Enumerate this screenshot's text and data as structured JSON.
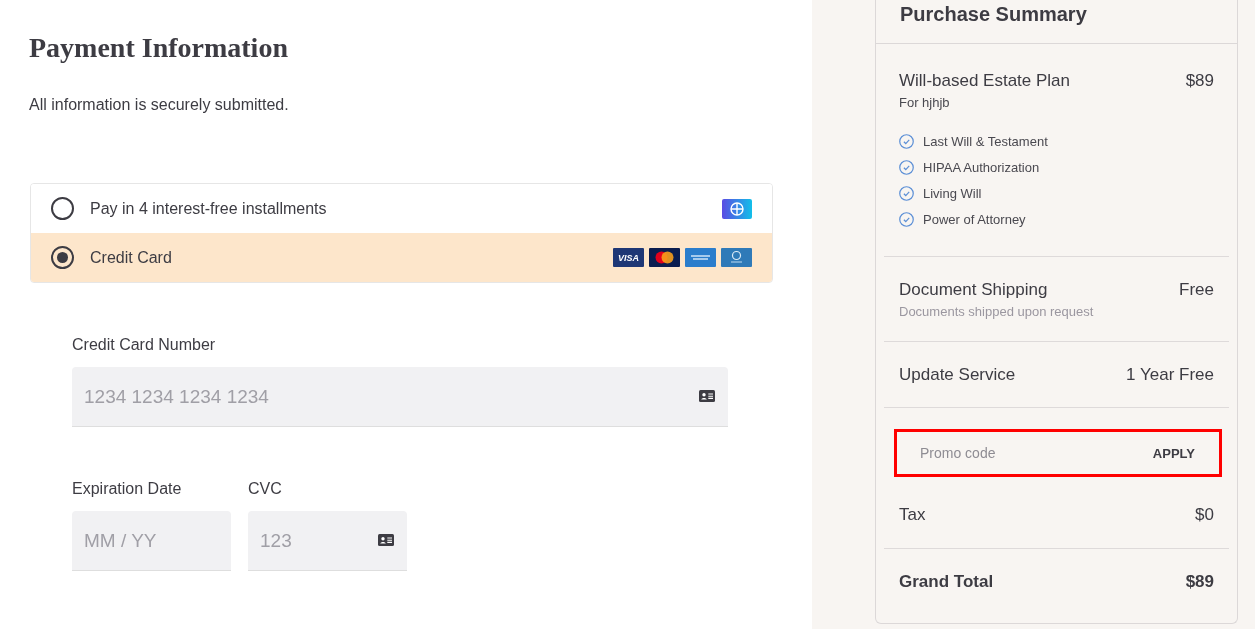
{
  "payment": {
    "title": "Payment Information",
    "subtitle": "All information is securely submitted.",
    "methods": [
      {
        "label": "Pay in 4 interest-free installments",
        "selected": false,
        "kind": "installments"
      },
      {
        "label": "Credit Card",
        "selected": true,
        "kind": "card",
        "brands": [
          {
            "kind": "visa",
            "text": "VISA"
          },
          {
            "kind": "mastercard"
          },
          {
            "kind": "amex"
          },
          {
            "kind": "diners"
          }
        ]
      }
    ],
    "card_number": {
      "label": "Credit Card Number",
      "placeholder": "1234 1234 1234 1234"
    },
    "expiry": {
      "label": "Expiration Date",
      "placeholder": "MM / YY"
    },
    "cvc": {
      "label": "CVC",
      "placeholder": "123"
    }
  },
  "summary": {
    "title": "Purchase Summary",
    "items": [
      {
        "kind": "plan",
        "name": "Will-based Estate Plan",
        "price": "$89",
        "note": "For hjhjb",
        "features": [
          "Last Will & Testament",
          "HIPAA Authorization",
          "Living Will",
          "Power of Attorney"
        ]
      },
      {
        "kind": "shipping",
        "name": "Document Shipping",
        "price": "Free",
        "note": "Documents shipped upon request"
      },
      {
        "kind": "service",
        "name": "Update Service",
        "price": "1 Year Free"
      }
    ],
    "promo": {
      "placeholder": "Promo code",
      "button": "APPLY",
      "highlighted": true
    },
    "tax": {
      "label": "Tax",
      "value": "$0"
    },
    "total": {
      "label": "Grand Total",
      "value": "$89"
    }
  }
}
